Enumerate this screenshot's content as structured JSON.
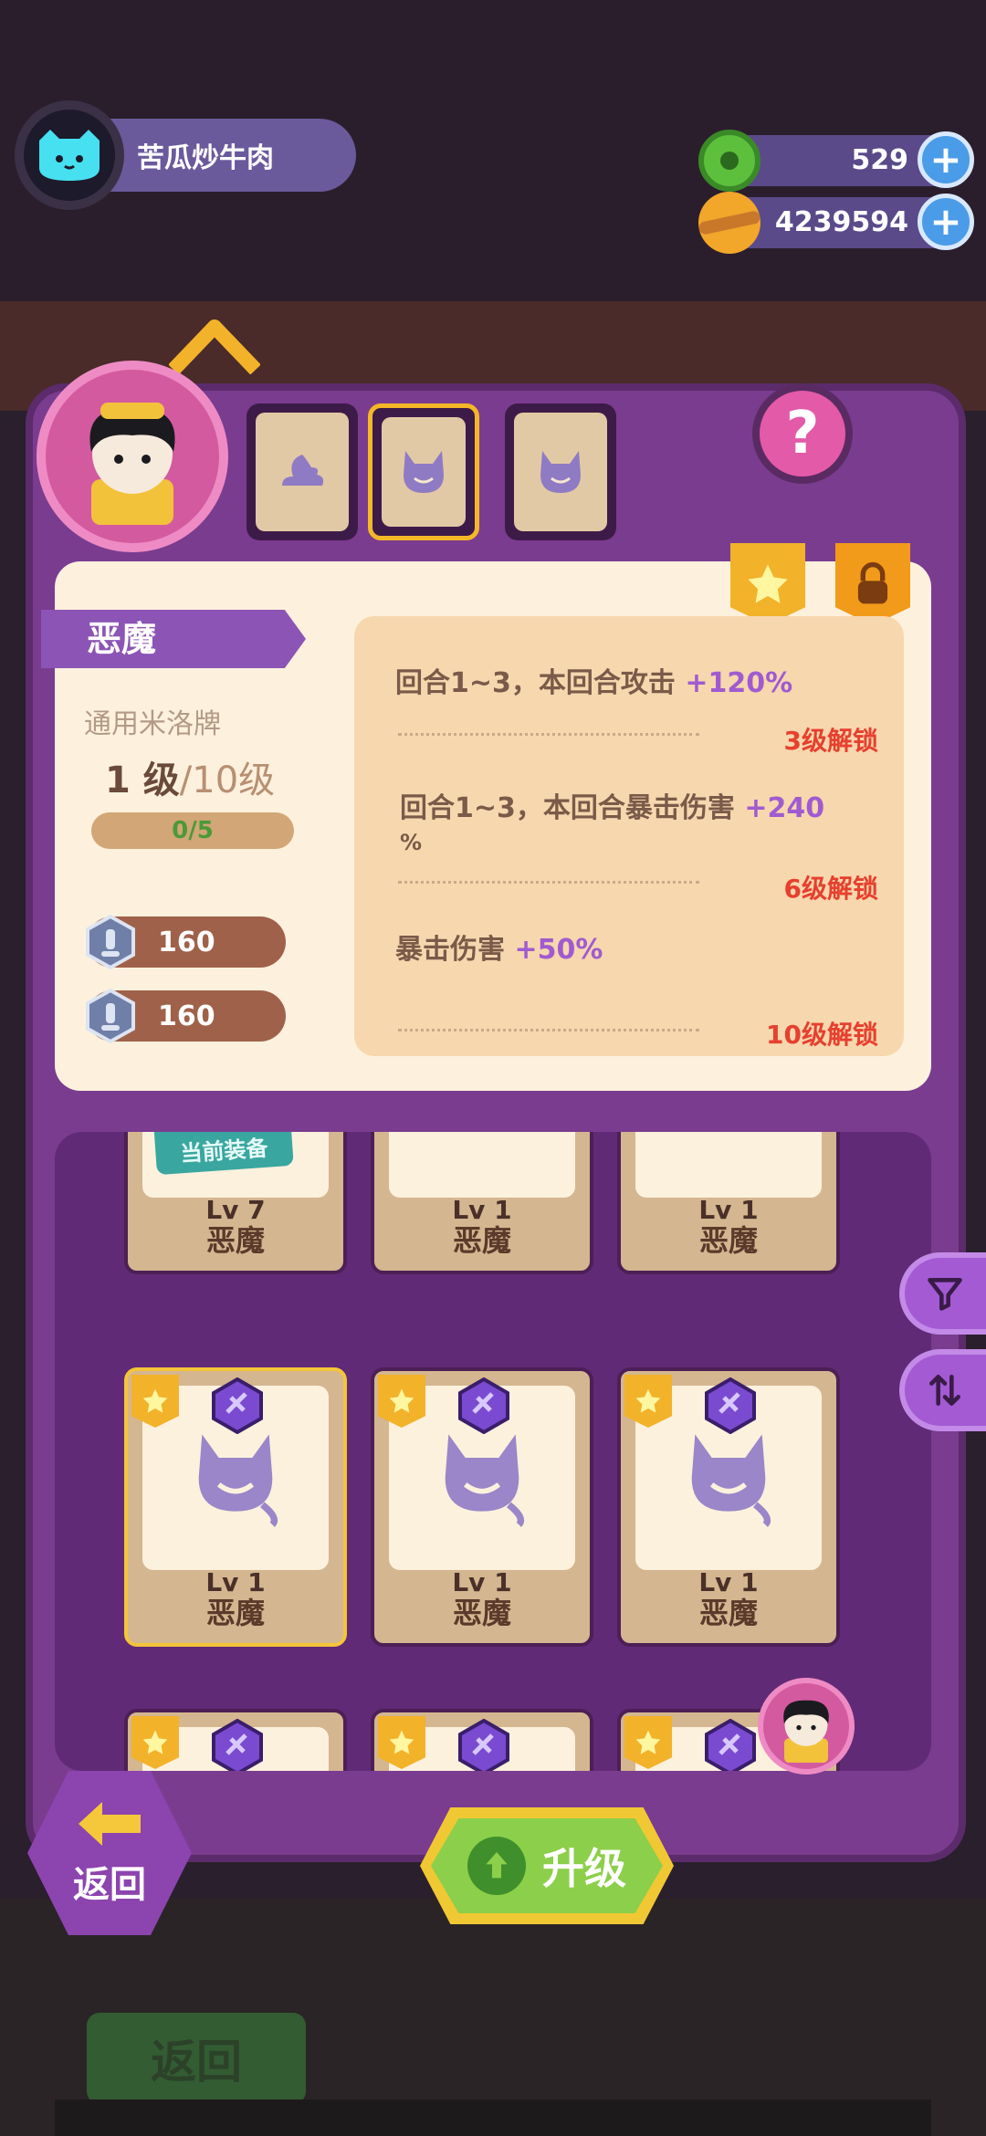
{
  "header": {
    "player_name": "苦瓜炒牛肉",
    "currencies": [
      {
        "icon": "green-donut-coin-icon",
        "value": "529"
      },
      {
        "icon": "planet-coin-icon",
        "value": "4239594"
      }
    ]
  },
  "card_tabs": [
    {
      "icon": "moon-cloud-icon",
      "selected": false
    },
    {
      "icon": "devil-icon",
      "selected": true
    },
    {
      "icon": "devil-icon",
      "selected": false
    }
  ],
  "card_info": {
    "name": "恶魔",
    "subtype": "通用米洛牌",
    "level_current": "1 级",
    "level_max": "/10级",
    "progress_text": "0/5",
    "progress_fraction": 0,
    "costs": [
      "160",
      "160"
    ]
  },
  "effects": [
    {
      "text": "回合1~3，本回合攻击 ",
      "value": "+120%",
      "unlock": "3级解锁"
    },
    {
      "text": "回合1~3，本回合暴击伤害 ",
      "value": "+240",
      "tail": "%",
      "unlock": "6级解锁"
    },
    {
      "text": "暴击伤害 ",
      "value": "+50%",
      "unlock": "10级解锁"
    }
  ],
  "grid": {
    "equipped_label": "当前装备",
    "cards": [
      {
        "lv": "Lv 7",
        "name": "恶魔"
      },
      {
        "lv": "Lv 1",
        "name": "恶魔"
      },
      {
        "lv": "Lv 1",
        "name": "恶魔"
      },
      {
        "lv": "Lv 1",
        "name": "恶魔"
      },
      {
        "lv": "Lv 1",
        "name": "恶魔"
      },
      {
        "lv": "Lv 1",
        "name": "恶魔"
      }
    ]
  },
  "buttons": {
    "back": "返回",
    "upgrade": "升级",
    "background_back": "返回"
  },
  "colors": {
    "panel": "#7a3c8f",
    "accent_purple": "#a05bd0",
    "unlock_red": "#e6402e",
    "upgrade_green": "#8ccf4a"
  }
}
